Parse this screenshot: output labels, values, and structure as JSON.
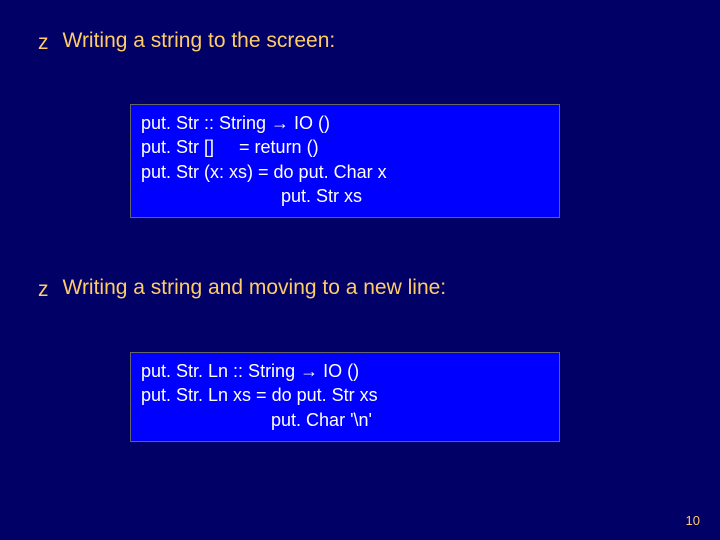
{
  "bullets": {
    "one": {
      "marker": "z",
      "text": "Writing a string to the screen:"
    },
    "two": {
      "marker": "z",
      "text": "Writing a string and moving to a new line:"
    }
  },
  "code_box_1": {
    "line1": "put. Str :: String → IO ()",
    "line2": "put. Str []     = return ()",
    "line3": "put. Str (x: xs) = do put. Char x",
    "line4": "                            put. Str xs"
  },
  "code_box_2": {
    "line1": "put. Str. Ln :: String → IO ()",
    "line2": "put. Str. Ln xs = do put. Str xs",
    "line3": "                          put. Char '\\n'"
  },
  "page_number": "10"
}
